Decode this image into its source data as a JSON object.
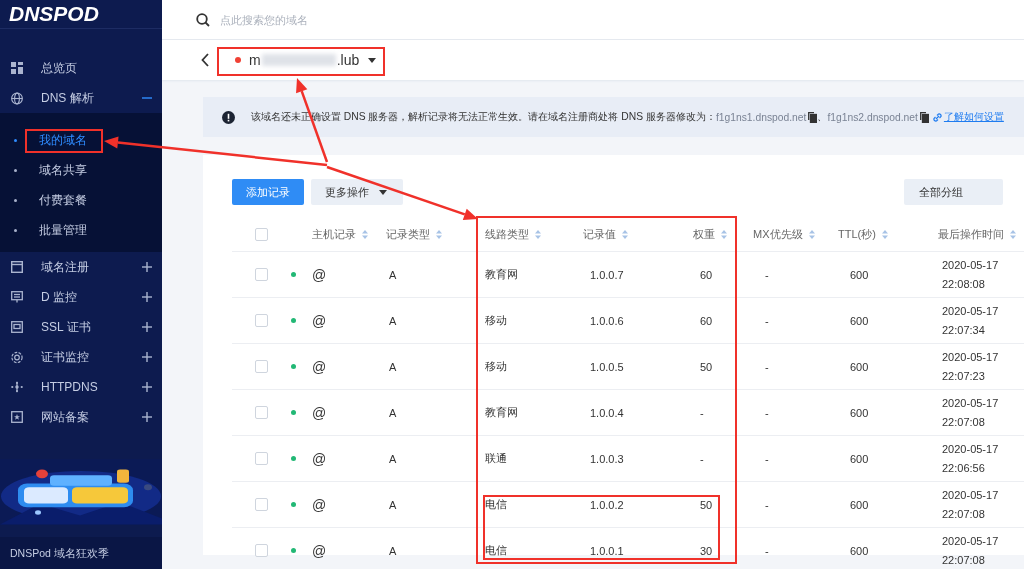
{
  "sidebar": {
    "logo": "DNSPOD",
    "items": [
      {
        "label": "总览页"
      },
      {
        "label": "DNS 解析",
        "expanded": true,
        "children": [
          {
            "label": "我的域名",
            "selected": true
          },
          {
            "label": "域名共享",
            "selected": false
          },
          {
            "label": "付费套餐",
            "selected": false
          },
          {
            "label": "批量管理",
            "selected": false
          }
        ]
      },
      {
        "label": "域名注册",
        "expanded": false
      },
      {
        "label": "D 监控",
        "expanded": false
      },
      {
        "label": "SSL 证书",
        "expanded": false
      },
      {
        "label": "证书监控",
        "expanded": false
      },
      {
        "label": "HTTPDNS",
        "expanded": false
      },
      {
        "label": "网站备案",
        "expanded": false
      }
    ],
    "promo": {
      "kind": "picture",
      "caption": "DNSPod 域名狂欢季"
    }
  },
  "search": {
    "placeholder": "点此搜索您的域名"
  },
  "domain": {
    "name_start": "m",
    "name_end": ".lub"
  },
  "notice": {
    "text": "该域名还未正确设置 DNS 服务器，解析记录将无法正常生效。请在域名注册商处将 DNS 服务器修改为：",
    "servers": [
      "f1g1ns1.dnspod.net",
      "f1g1ns2.dnspod.net"
    ],
    "separator": "、",
    "link": "了解如何设置"
  },
  "toolbar": {
    "buttons": [
      "添加记录",
      "更多操作"
    ],
    "group_button": "全部分组"
  },
  "table": {
    "header_checked": false,
    "columns": [
      "主机记录",
      "记录类型",
      "线路类型",
      "记录值",
      "权重",
      "MX优先级",
      "TTL(秒)",
      "最后操作时间"
    ],
    "rows": [
      {
        "checked": false,
        "enabled": true,
        "host": "@",
        "type": "A",
        "line": "教育网",
        "value": "1.0.0.7",
        "weight": "60",
        "mx": "-",
        "ttl": "600",
        "date": "2020-05-17",
        "time": "22:08:08"
      },
      {
        "checked": false,
        "enabled": true,
        "host": "@",
        "type": "A",
        "line": "移动",
        "value": "1.0.0.6",
        "weight": "60",
        "mx": "-",
        "ttl": "600",
        "date": "2020-05-17",
        "time": "22:07:34"
      },
      {
        "checked": false,
        "enabled": true,
        "host": "@",
        "type": "A",
        "line": "移动",
        "value": "1.0.0.5",
        "weight": "50",
        "mx": "-",
        "ttl": "600",
        "date": "2020-05-17",
        "time": "22:07:23"
      },
      {
        "checked": false,
        "enabled": true,
        "host": "@",
        "type": "A",
        "line": "教育网",
        "value": "1.0.0.4",
        "weight": "-",
        "mx": "-",
        "ttl": "600",
        "date": "2020-05-17",
        "time": "22:07:08"
      },
      {
        "checked": false,
        "enabled": true,
        "host": "@",
        "type": "A",
        "line": "联通",
        "value": "1.0.0.3",
        "weight": "-",
        "mx": "-",
        "ttl": "600",
        "date": "2020-05-17",
        "time": "22:06:56"
      },
      {
        "checked": false,
        "enabled": true,
        "host": "@",
        "type": "A",
        "line": "电信",
        "value": "1.0.0.2",
        "weight": "50",
        "mx": "-",
        "ttl": "600",
        "date": "2020-05-17",
        "time": "22:07:08"
      },
      {
        "checked": false,
        "enabled": true,
        "host": "@",
        "type": "A",
        "line": "电信",
        "value": "1.0.0.1",
        "weight": "30",
        "mx": "-",
        "ttl": "600",
        "date": "2020-05-17",
        "time": "22:07:08"
      }
    ]
  }
}
